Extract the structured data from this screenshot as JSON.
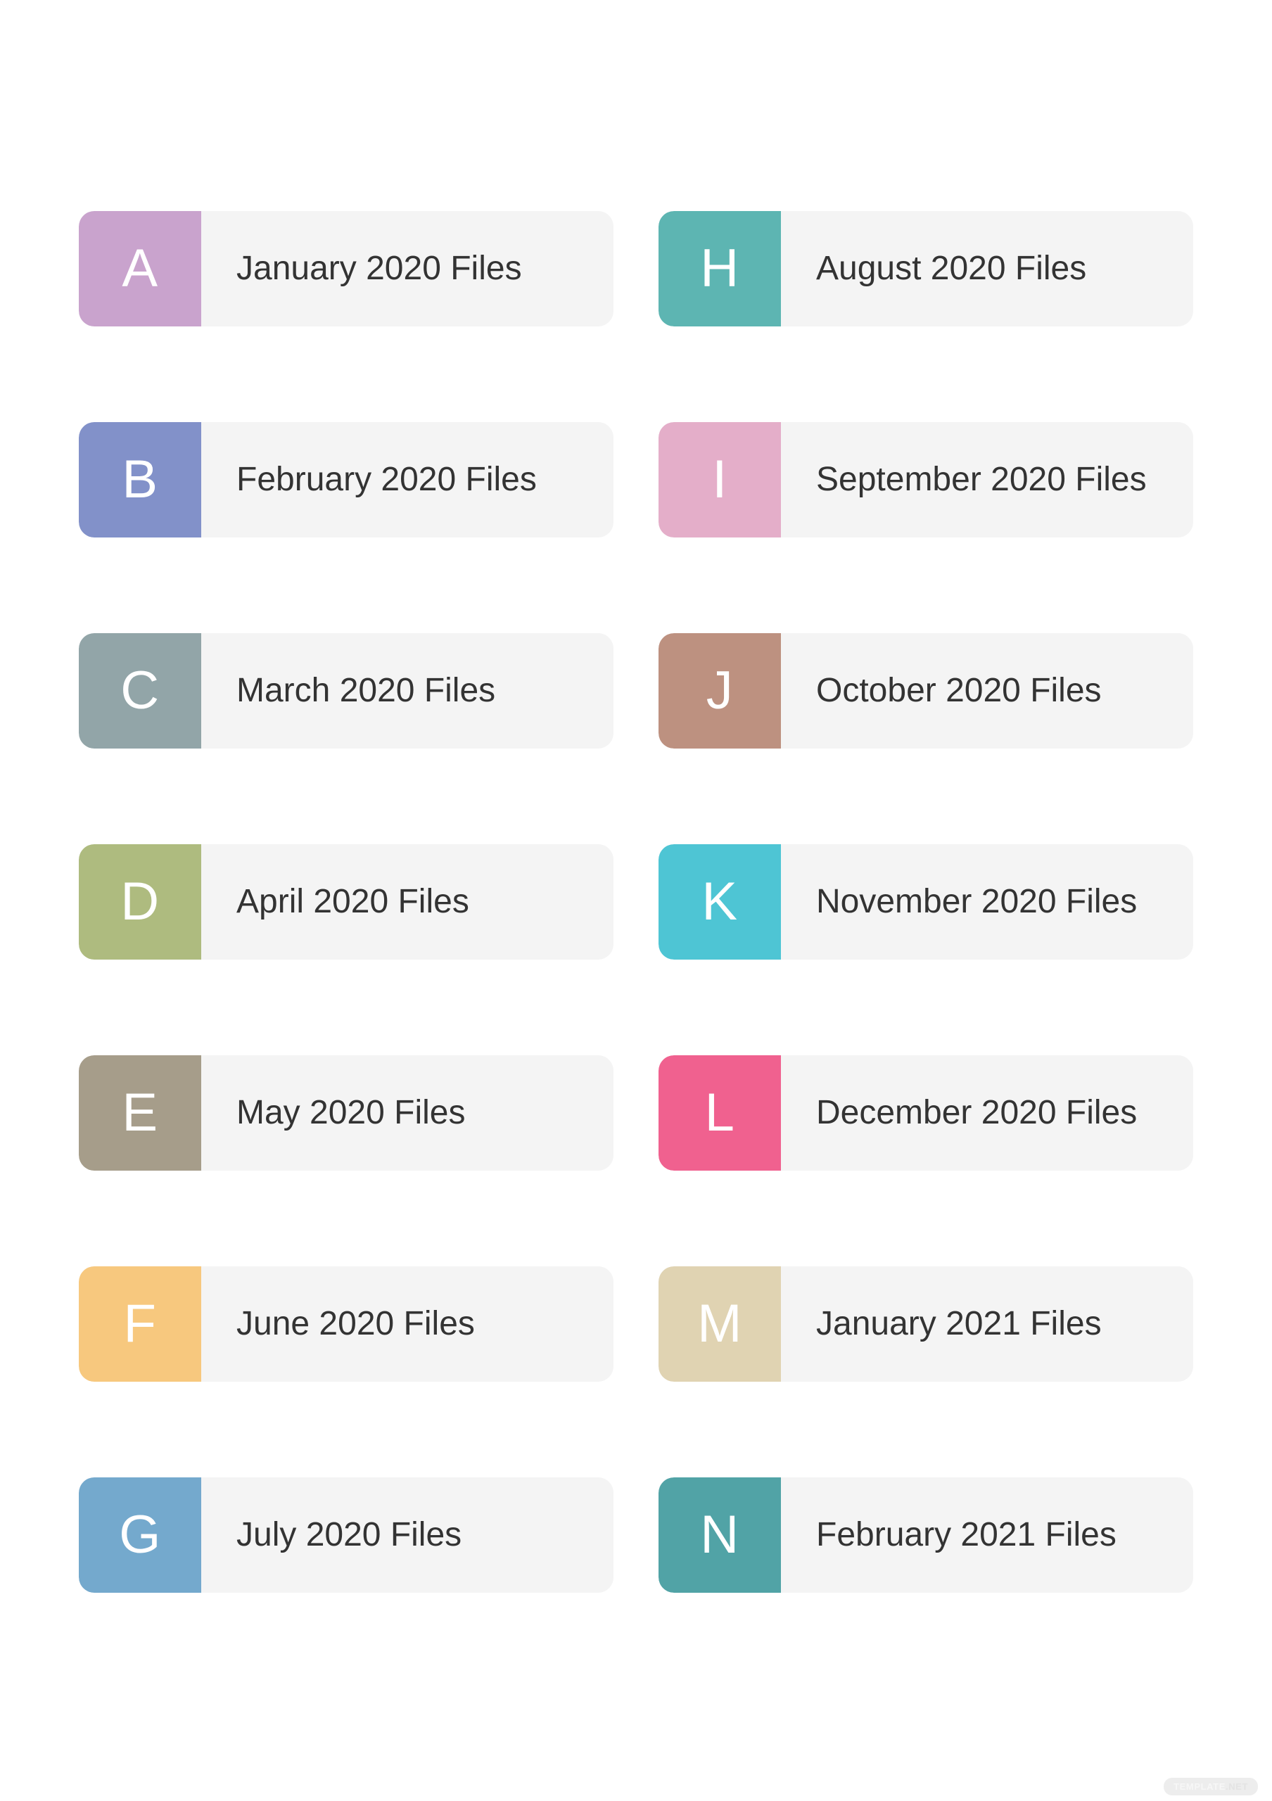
{
  "page": {
    "background_color": "#ffffff",
    "label_body_color": "#f4f4f4",
    "label_text_color": "#333333",
    "letter_text_color": "#ffffff"
  },
  "watermark": {
    "text": "TEMPLATE",
    "suffix": ".NET"
  },
  "labels": [
    {
      "letter": "A",
      "title": "January 2020 Files",
      "color": "#c9a3cd"
    },
    {
      "letter": "H",
      "title": "August 2020 Files",
      "color": "#5db5b2"
    },
    {
      "letter": "B",
      "title": "February 2020 Files",
      "color": "#8291c9"
    },
    {
      "letter": "I",
      "title": "September 2020 Files",
      "color": "#e4aec9"
    },
    {
      "letter": "C",
      "title": "March 2020 Files",
      "color": "#92a5a8"
    },
    {
      "letter": "J",
      "title": "October 2020 Files",
      "color": "#bd9180"
    },
    {
      "letter": "D",
      "title": "April 2020 Files",
      "color": "#aebb7f"
    },
    {
      "letter": "K",
      "title": "November 2020 Files",
      "color": "#4ec5d4"
    },
    {
      "letter": "E",
      "title": "May 2020 Files",
      "color": "#a69d8a"
    },
    {
      "letter": "L",
      "title": "December 2020 Files",
      "color": "#f0618f"
    },
    {
      "letter": "F",
      "title": "June 2020 Files",
      "color": "#f7c87e"
    },
    {
      "letter": "M",
      "title": "January 2021 Files",
      "color": "#e0d3b2"
    },
    {
      "letter": "G",
      "title": "July 2020 Files",
      "color": "#74a9cd"
    },
    {
      "letter": "N",
      "title": "February 2021 Files",
      "color": "#51a3a6"
    }
  ]
}
